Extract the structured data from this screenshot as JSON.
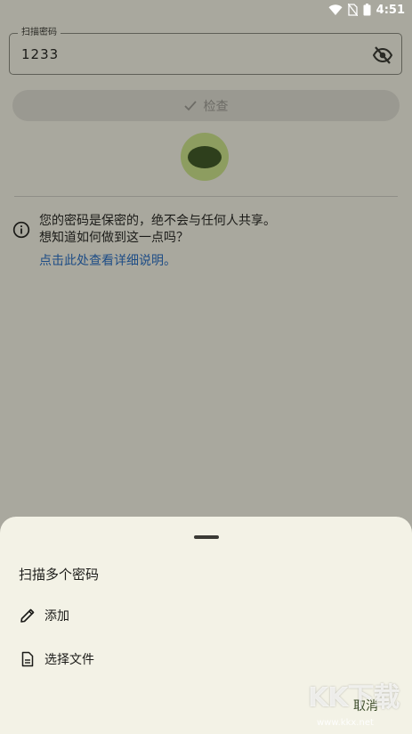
{
  "status_bar": {
    "time": "4:51"
  },
  "password_field": {
    "label": "扫描密码",
    "value": "1233"
  },
  "check_button": {
    "label": "检查"
  },
  "info": {
    "text_line1": "您的密码是保密的，绝不会与任何人共享。",
    "text_line2": "想知道如何做到这一点吗？",
    "link": "点击此处查看详细说明。"
  },
  "sheet": {
    "title": "扫描多个密码",
    "items": [
      {
        "label": "添加",
        "icon": "pencil-icon"
      },
      {
        "label": "选择文件",
        "icon": "document-icon"
      }
    ],
    "cancel_label": "取消"
  },
  "watermark": {
    "brand": "KK下载",
    "url": "www.kkx.net"
  },
  "colors": {
    "scrim_background": "#a9a89e",
    "sheet_background": "#f3f2e6",
    "link": "#1e4d86",
    "accent_green": "#8d9d60"
  }
}
